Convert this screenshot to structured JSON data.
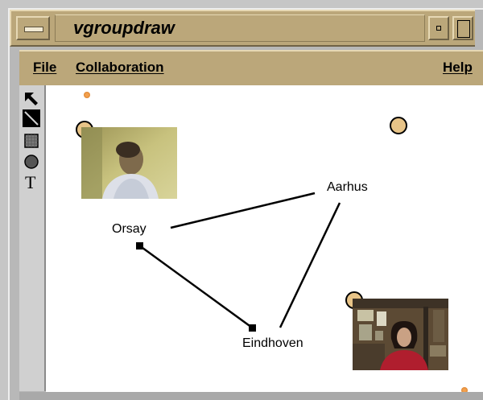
{
  "window": {
    "title": "vgroupdraw"
  },
  "menubar": {
    "file": "File",
    "collaboration": "Collaboration",
    "help": "Help"
  },
  "tools": [
    {
      "name": "arrow-select-tool",
      "glyph": "↖"
    },
    {
      "name": "line-tool",
      "glyph": "╲"
    },
    {
      "name": "rectangle-tool",
      "glyph": "▦"
    },
    {
      "name": "ellipse-tool",
      "glyph": "●"
    },
    {
      "name": "text-tool",
      "glyph": "T"
    }
  ],
  "canvas": {
    "labels": {
      "orsay": "Orsay",
      "aarhus": "Aarhus",
      "eindhoven": "Eindhoven"
    }
  },
  "colors": {
    "title_bar": "#bba77a",
    "canvas": "#ffffff",
    "marker_fill": "#e8c488",
    "cursor_dot": "#e8882e"
  }
}
